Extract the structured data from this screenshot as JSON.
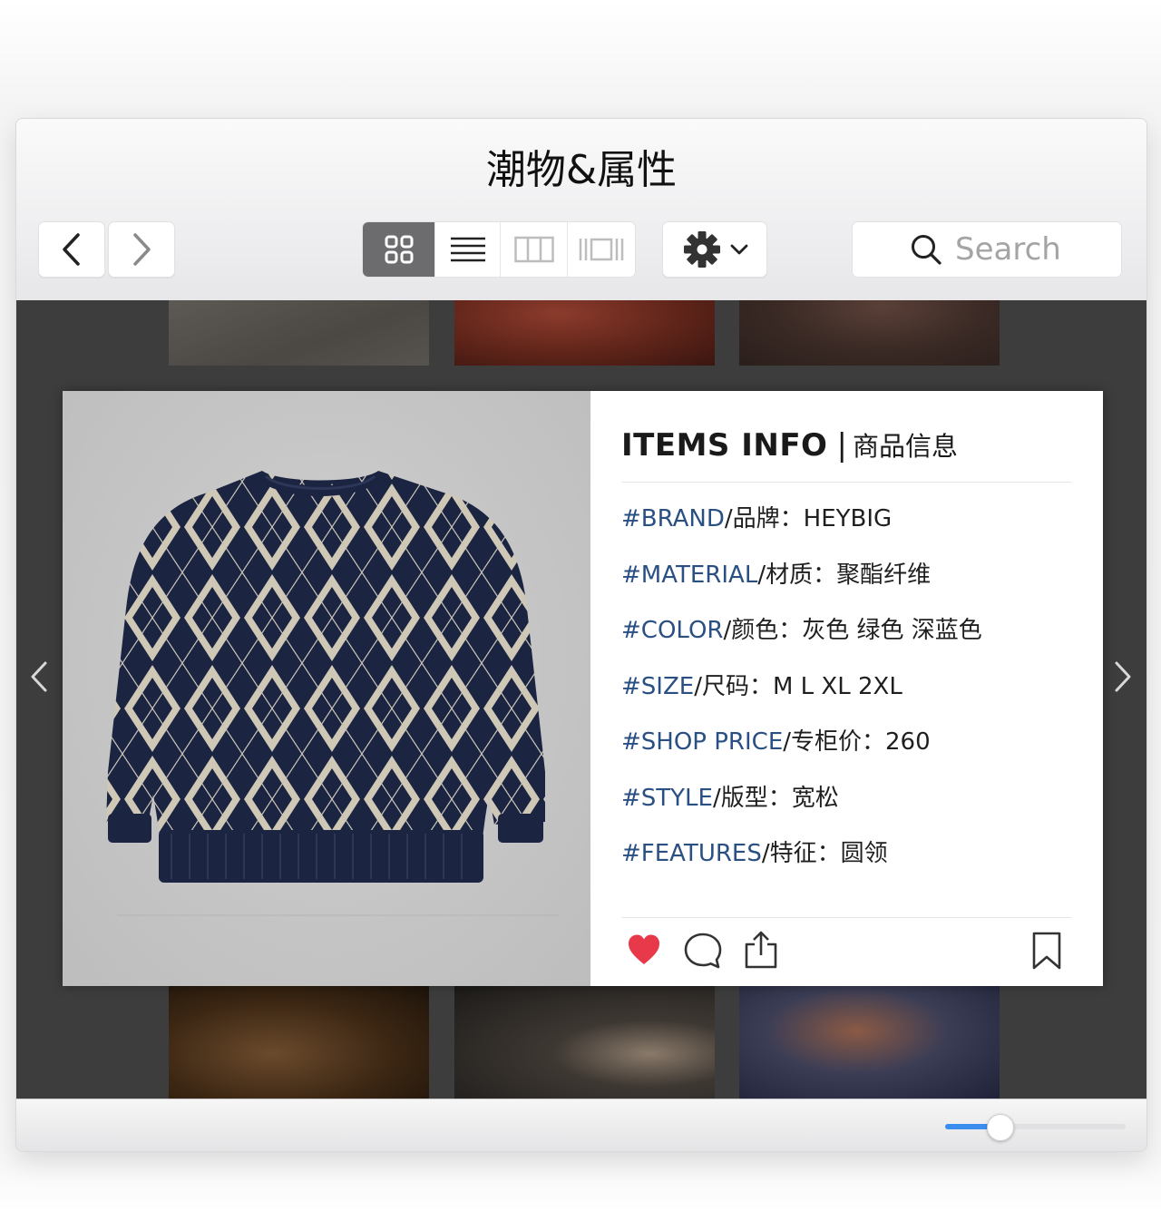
{
  "window": {
    "title": "潮物&属性"
  },
  "toolbar": {
    "back_icon": "chevron-left-icon",
    "forward_icon": "chevron-right-icon",
    "view_modes": [
      "grid-view-icon",
      "list-view-icon",
      "column-view-icon",
      "coverflow-view-icon"
    ],
    "active_view": "grid",
    "settings_icon": "gear-icon",
    "search_placeholder": "Search"
  },
  "info": {
    "title_en": "ITEMS INFO",
    "separator": "|",
    "title_cn": "商品信息",
    "attributes": [
      {
        "tag": "#BRAND",
        "text": "/品牌：HEYBIG"
      },
      {
        "tag": "#MATERIAL",
        "text": "/材质：聚酯纤维"
      },
      {
        "tag": "#COLOR",
        "text": "/颜色：灰色 绿色 深蓝色"
      },
      {
        "tag": "#SIZE",
        "text": "/尺码：M L XL 2XL"
      },
      {
        "tag": "#SHOP PRICE",
        "text": "/专柜价：260"
      },
      {
        "tag": "#STYLE",
        "text": "/版型：宽松"
      },
      {
        "tag": "#FEATURES",
        "text": "/特征：圆领"
      }
    ],
    "actions": [
      "heart-icon",
      "comment-icon",
      "share-icon",
      "bookmark-icon"
    ]
  },
  "colors": {
    "accent_blue": "#3b8df0",
    "tag_blue": "#2a4f83",
    "heart_red": "#e8394b",
    "sweater_navy": "#1b2440"
  },
  "zoom_slider": {
    "value": 0.3
  }
}
